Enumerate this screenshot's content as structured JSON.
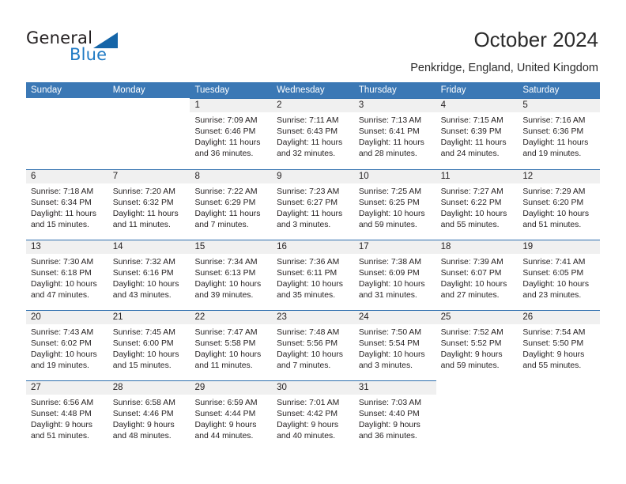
{
  "brand": {
    "name_part1": "General",
    "name_part2": "Blue"
  },
  "header": {
    "title": "October 2024",
    "subtitle": "Penkridge, England, United Kingdom"
  },
  "colors": {
    "header_blue": "#3b78b5",
    "separator_blue": "#2f6fae",
    "daynum_band": "#f0f0f0",
    "logo_blue": "#1f7ac4"
  },
  "weekdays": [
    "Sunday",
    "Monday",
    "Tuesday",
    "Wednesday",
    "Thursday",
    "Friday",
    "Saturday"
  ],
  "labels": {
    "sunrise_prefix": "Sunrise:",
    "sunset_prefix": "Sunset:",
    "daylight_prefix": "Daylight:"
  },
  "weeks": [
    [
      {
        "empty": true
      },
      {
        "empty": true
      },
      {
        "day": "1",
        "sunrise": "Sunrise: 7:09 AM",
        "sunset": "Sunset: 6:46 PM",
        "daylight": "Daylight: 11 hours and 36 minutes."
      },
      {
        "day": "2",
        "sunrise": "Sunrise: 7:11 AM",
        "sunset": "Sunset: 6:43 PM",
        "daylight": "Daylight: 11 hours and 32 minutes."
      },
      {
        "day": "3",
        "sunrise": "Sunrise: 7:13 AM",
        "sunset": "Sunset: 6:41 PM",
        "daylight": "Daylight: 11 hours and 28 minutes."
      },
      {
        "day": "4",
        "sunrise": "Sunrise: 7:15 AM",
        "sunset": "Sunset: 6:39 PM",
        "daylight": "Daylight: 11 hours and 24 minutes."
      },
      {
        "day": "5",
        "sunrise": "Sunrise: 7:16 AM",
        "sunset": "Sunset: 6:36 PM",
        "daylight": "Daylight: 11 hours and 19 minutes."
      }
    ],
    [
      {
        "day": "6",
        "sunrise": "Sunrise: 7:18 AM",
        "sunset": "Sunset: 6:34 PM",
        "daylight": "Daylight: 11 hours and 15 minutes."
      },
      {
        "day": "7",
        "sunrise": "Sunrise: 7:20 AM",
        "sunset": "Sunset: 6:32 PM",
        "daylight": "Daylight: 11 hours and 11 minutes."
      },
      {
        "day": "8",
        "sunrise": "Sunrise: 7:22 AM",
        "sunset": "Sunset: 6:29 PM",
        "daylight": "Daylight: 11 hours and 7 minutes."
      },
      {
        "day": "9",
        "sunrise": "Sunrise: 7:23 AM",
        "sunset": "Sunset: 6:27 PM",
        "daylight": "Daylight: 11 hours and 3 minutes."
      },
      {
        "day": "10",
        "sunrise": "Sunrise: 7:25 AM",
        "sunset": "Sunset: 6:25 PM",
        "daylight": "Daylight: 10 hours and 59 minutes."
      },
      {
        "day": "11",
        "sunrise": "Sunrise: 7:27 AM",
        "sunset": "Sunset: 6:22 PM",
        "daylight": "Daylight: 10 hours and 55 minutes."
      },
      {
        "day": "12",
        "sunrise": "Sunrise: 7:29 AM",
        "sunset": "Sunset: 6:20 PM",
        "daylight": "Daylight: 10 hours and 51 minutes."
      }
    ],
    [
      {
        "day": "13",
        "sunrise": "Sunrise: 7:30 AM",
        "sunset": "Sunset: 6:18 PM",
        "daylight": "Daylight: 10 hours and 47 minutes."
      },
      {
        "day": "14",
        "sunrise": "Sunrise: 7:32 AM",
        "sunset": "Sunset: 6:16 PM",
        "daylight": "Daylight: 10 hours and 43 minutes."
      },
      {
        "day": "15",
        "sunrise": "Sunrise: 7:34 AM",
        "sunset": "Sunset: 6:13 PM",
        "daylight": "Daylight: 10 hours and 39 minutes."
      },
      {
        "day": "16",
        "sunrise": "Sunrise: 7:36 AM",
        "sunset": "Sunset: 6:11 PM",
        "daylight": "Daylight: 10 hours and 35 minutes."
      },
      {
        "day": "17",
        "sunrise": "Sunrise: 7:38 AM",
        "sunset": "Sunset: 6:09 PM",
        "daylight": "Daylight: 10 hours and 31 minutes."
      },
      {
        "day": "18",
        "sunrise": "Sunrise: 7:39 AM",
        "sunset": "Sunset: 6:07 PM",
        "daylight": "Daylight: 10 hours and 27 minutes."
      },
      {
        "day": "19",
        "sunrise": "Sunrise: 7:41 AM",
        "sunset": "Sunset: 6:05 PM",
        "daylight": "Daylight: 10 hours and 23 minutes."
      }
    ],
    [
      {
        "day": "20",
        "sunrise": "Sunrise: 7:43 AM",
        "sunset": "Sunset: 6:02 PM",
        "daylight": "Daylight: 10 hours and 19 minutes."
      },
      {
        "day": "21",
        "sunrise": "Sunrise: 7:45 AM",
        "sunset": "Sunset: 6:00 PM",
        "daylight": "Daylight: 10 hours and 15 minutes."
      },
      {
        "day": "22",
        "sunrise": "Sunrise: 7:47 AM",
        "sunset": "Sunset: 5:58 PM",
        "daylight": "Daylight: 10 hours and 11 minutes."
      },
      {
        "day": "23",
        "sunrise": "Sunrise: 7:48 AM",
        "sunset": "Sunset: 5:56 PM",
        "daylight": "Daylight: 10 hours and 7 minutes."
      },
      {
        "day": "24",
        "sunrise": "Sunrise: 7:50 AM",
        "sunset": "Sunset: 5:54 PM",
        "daylight": "Daylight: 10 hours and 3 minutes."
      },
      {
        "day": "25",
        "sunrise": "Sunrise: 7:52 AM",
        "sunset": "Sunset: 5:52 PM",
        "daylight": "Daylight: 9 hours and 59 minutes."
      },
      {
        "day": "26",
        "sunrise": "Sunrise: 7:54 AM",
        "sunset": "Sunset: 5:50 PM",
        "daylight": "Daylight: 9 hours and 55 minutes."
      }
    ],
    [
      {
        "day": "27",
        "sunrise": "Sunrise: 6:56 AM",
        "sunset": "Sunset: 4:48 PM",
        "daylight": "Daylight: 9 hours and 51 minutes."
      },
      {
        "day": "28",
        "sunrise": "Sunrise: 6:58 AM",
        "sunset": "Sunset: 4:46 PM",
        "daylight": "Daylight: 9 hours and 48 minutes."
      },
      {
        "day": "29",
        "sunrise": "Sunrise: 6:59 AM",
        "sunset": "Sunset: 4:44 PM",
        "daylight": "Daylight: 9 hours and 44 minutes."
      },
      {
        "day": "30",
        "sunrise": "Sunrise: 7:01 AM",
        "sunset": "Sunset: 4:42 PM",
        "daylight": "Daylight: 9 hours and 40 minutes."
      },
      {
        "day": "31",
        "sunrise": "Sunrise: 7:03 AM",
        "sunset": "Sunset: 4:40 PM",
        "daylight": "Daylight: 9 hours and 36 minutes."
      },
      {
        "empty": true
      },
      {
        "empty": true
      }
    ]
  ]
}
